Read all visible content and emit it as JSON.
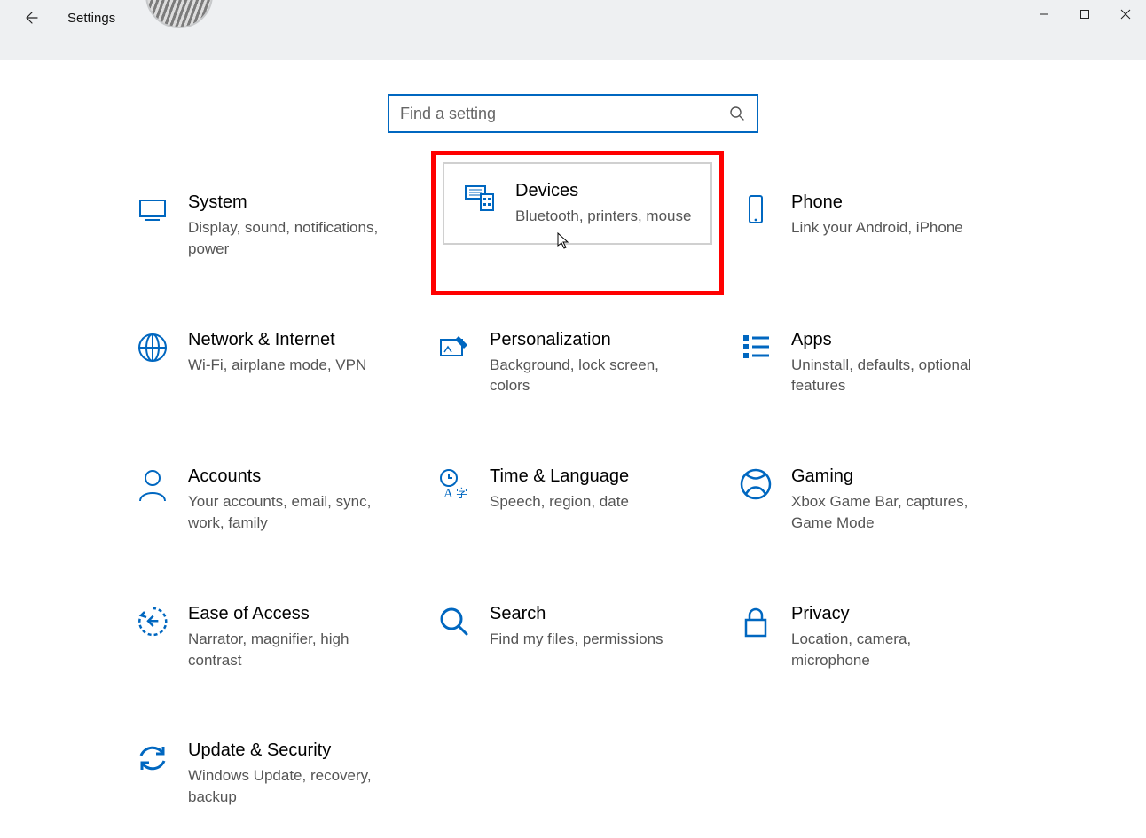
{
  "window": {
    "title": "Settings"
  },
  "search": {
    "placeholder": "Find a setting"
  },
  "tiles": {
    "system": {
      "title": "System",
      "desc": "Display, sound, notifications, power"
    },
    "devices": {
      "title": "Devices",
      "desc": "Bluetooth, printers, mouse"
    },
    "phone": {
      "title": "Phone",
      "desc": "Link your Android, iPhone"
    },
    "network": {
      "title": "Network & Internet",
      "desc": "Wi-Fi, airplane mode, VPN"
    },
    "personalization": {
      "title": "Personalization",
      "desc": "Background, lock screen, colors"
    },
    "apps": {
      "title": "Apps",
      "desc": "Uninstall, defaults, optional features"
    },
    "accounts": {
      "title": "Accounts",
      "desc": "Your accounts, email, sync, work, family"
    },
    "time": {
      "title": "Time & Language",
      "desc": "Speech, region, date"
    },
    "gaming": {
      "title": "Gaming",
      "desc": "Xbox Game Bar, captures, Game Mode"
    },
    "ease": {
      "title": "Ease of Access",
      "desc": "Narrator, magnifier, high contrast"
    },
    "searchTile": {
      "title": "Search",
      "desc": "Find my files, permissions"
    },
    "privacy": {
      "title": "Privacy",
      "desc": "Location, camera, microphone"
    },
    "update": {
      "title": "Update & Security",
      "desc": "Windows Update, recovery, backup"
    }
  },
  "colors": {
    "accent": "#0067c0",
    "highlight": "#ff0000"
  }
}
